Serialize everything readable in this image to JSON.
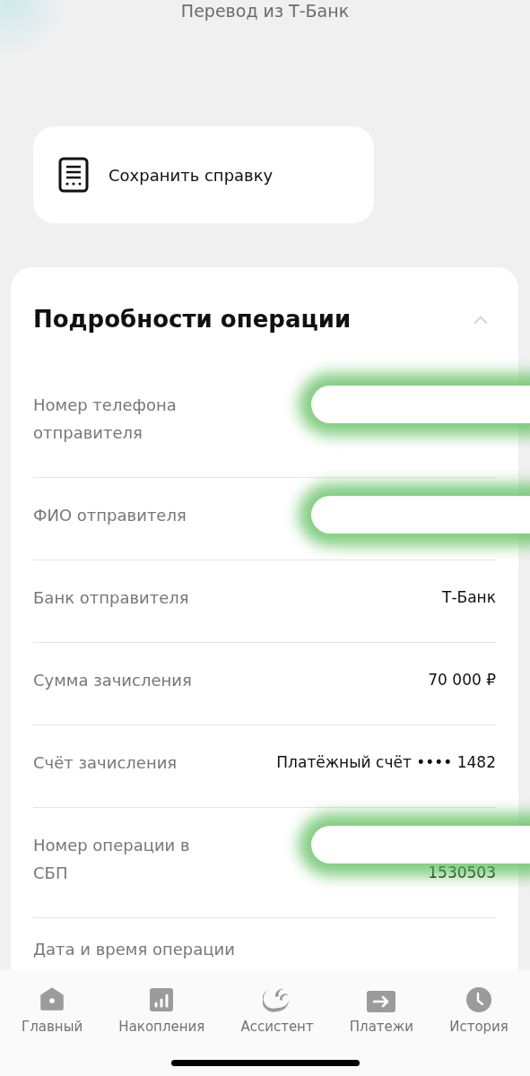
{
  "header": {
    "title": "Перевод из Т-Банк"
  },
  "action": {
    "label": "Сохранить справку"
  },
  "details": {
    "title": "Подробности операции",
    "expanded": true,
    "rows": [
      {
        "label": "Номер телефона отправителя",
        "redacted": true
      },
      {
        "label": "ФИО отправителя",
        "redacted": true
      },
      {
        "label": "Банк отправителя",
        "value": "Т-Банк"
      },
      {
        "label": "Сумма зачисления",
        "value": "70 000 ₽"
      },
      {
        "label": "Счёт зачисления",
        "value": "Платёжный счёт •••• 1482"
      },
      {
        "label": "Номер операции в СБП",
        "value": "1530503",
        "redacted": true
      },
      {
        "label": "Дата и время операции"
      }
    ]
  },
  "nav": [
    {
      "kind": "home",
      "label": "Главный"
    },
    {
      "kind": "savings",
      "label": "Накопления"
    },
    {
      "kind": "assistant",
      "label": "Ассистент"
    },
    {
      "kind": "payments",
      "label": "Платежи"
    },
    {
      "kind": "history",
      "label": "История"
    }
  ]
}
